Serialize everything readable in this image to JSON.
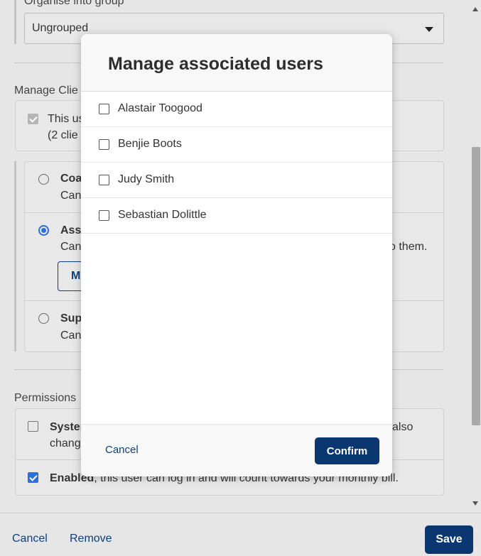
{
  "background": {
    "group": {
      "label": "Organise into group",
      "selected": "Ungrouped"
    },
    "manage_clients": {
      "title": "Manage Clie",
      "checkbox_line1": "This us",
      "checkbox_line2": "(2 clie",
      "options": [
        {
          "title": "Coa",
          "desc": "Can",
          "selected": false
        },
        {
          "title": "Asso",
          "desc": "Can",
          "desc_tail": "o them.",
          "selected": true,
          "button_label": "M"
        },
        {
          "title": "Sup",
          "desc": "Can",
          "selected": false
        }
      ]
    },
    "permissions": {
      "title": "Permissions",
      "system_title": "Syster",
      "system_line2": "chang",
      "system_tail": "also",
      "enabled_title": "Enabled",
      "enabled_text": ", this user can log in and will count towards your monthly bill."
    },
    "footer": {
      "cancel": "Cancel",
      "remove": "Remove",
      "save": "Save"
    }
  },
  "modal": {
    "title": "Manage associated users",
    "users": [
      {
        "name": "Alastair Toogood",
        "checked": false
      },
      {
        "name": "Benjie Boots",
        "checked": false
      },
      {
        "name": "Judy Smith",
        "checked": false
      },
      {
        "name": "Sebastian Dolittle",
        "checked": false
      }
    ],
    "cancel_label": "Cancel",
    "confirm_label": "Confirm"
  },
  "colors": {
    "primary": "#0b3770",
    "link": "#0e3f7e",
    "accent": "#2a6fdb"
  }
}
